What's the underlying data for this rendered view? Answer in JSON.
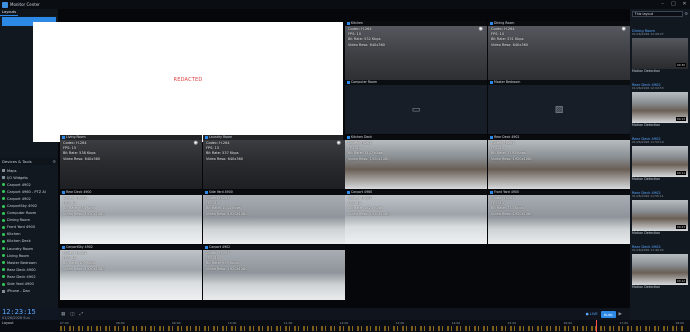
{
  "app": {
    "title": "Monitor Center"
  },
  "window_controls": [
    "–",
    "□",
    "✕"
  ],
  "left": {
    "tabs": [
      "Layouts"
    ],
    "cameras_header": "Devices & Tools",
    "items": [
      "Maps",
      "I/O Widgets",
      "Carport 4902",
      "Carport 4960 - PTZ Al",
      "Carport 4902",
      "CarportSky 4902",
      "Computer Room",
      "Dining Room",
      "Front Yard 4900",
      "Kitchen",
      "Kitchen Deck",
      "Laundry Room",
      "Living Room",
      "Master Bedroom",
      "Rear Deck 4900",
      "Rear Deck 4902",
      "Side Yard 4900",
      "iPhone - Dan"
    ]
  },
  "clock": {
    "time": "12:23:15",
    "date": "01/26/2026 Sun"
  },
  "grid": {
    "redacted_text": "REDACTED",
    "cams": [
      {
        "name": "Kitchen",
        "codec": "Codec: H.264",
        "fps": "FPS:  10",
        "bitrate": "Bit Rate: 532 Kbps",
        "res": "Video Reso:  640x360"
      },
      {
        "name": "Dining Room",
        "codec": "Codec: H.264",
        "fps": "FPS:  10",
        "bitrate": "Bit Rate: 531 Kbps",
        "res": "Video Reso:  640x360"
      },
      {
        "name": "Computer Room"
      },
      {
        "name": "Master Bedroom"
      },
      {
        "name": "Living Room",
        "codec": "Codec: H.264",
        "fps": "FPS:  15",
        "bitrate": "Bit Rate: 538 Kbps",
        "res": "Video Reso:  640x360"
      },
      {
        "name": "Laundry Room",
        "codec": "Codec: H.264",
        "fps": "FPS:  15",
        "bitrate": "Bit Rate: 537 Kbps",
        "res": "Video Reso:  640x360"
      },
      {
        "name": "Kitchen Deck",
        "codec": "Codec: H.264",
        "fps": "FPS:  15",
        "bitrate": "Bit Rate: 1147 Kbps",
        "res": "Video Reso:  1920x1080"
      },
      {
        "name": "Rear Deck 4902",
        "codec": "Codec: H.264",
        "fps": "FPS:  15",
        "bitrate": "Bit Rate: 1793 Kbps",
        "res": "Video Reso:  1920x1080"
      },
      {
        "name": "Rear Deck 4900",
        "codec": "Codec: H.264",
        "fps": "FPS:  15",
        "bitrate": "Bit Rate: 938 Kbps",
        "res": "Video Reso:  1920x1080"
      },
      {
        "name": "Side Yard 4900",
        "codec": "Codec: H.264",
        "fps": "FPS:  15",
        "bitrate": "Bit Rate: 1044 Kbps",
        "res": "Video Reso:  1920x1080"
      },
      {
        "name": "Carport 4960",
        "codec": "Codec: H.264",
        "fps": "FPS:  15",
        "bitrate": "Bit Rate: 1623 Kbps",
        "res": "Video Reso:  1920x1080"
      },
      {
        "name": "Front Yard 4900",
        "codec": "Codec: H.264",
        "fps": "FPS:  15",
        "bitrate": "Bit Rate: 733 Kbps",
        "res": "Video Reso:  1920x1080"
      },
      {
        "name": "CarportSky 4902",
        "codec": "Codec: H.264",
        "fps": "FPS:  15",
        "bitrate": "Bit Rate: 109 Kbps",
        "res": "Video Reso:  1920x1080"
      },
      {
        "name": "Carport 4902",
        "codec": "Codec: H.264",
        "fps": "FPS:  15",
        "bitrate": "Bit Rate: 959 Kbps",
        "res": "Video Reso:  1920x1080"
      }
    ]
  },
  "right": {
    "layout_select": "This layout",
    "events": [
      {
        "name": "Dining Room",
        "date": "01/26/2026 12:08:27",
        "stamp": "00:30",
        "type": "Motion Detection"
      },
      {
        "name": "Rear Deck 4902",
        "date": "01/26/2026 12:04:53",
        "stamp": "00:13",
        "type": "Motion Detection"
      },
      {
        "name": "Rear Deck 4902",
        "date": "01/26/2026 11:59:19",
        "stamp": "00:11",
        "type": "Motion Detection"
      },
      {
        "name": "Rear Deck 4902",
        "date": "01/26/2026 11:55:11",
        "stamp": "00:23",
        "type": "Motion Detection"
      },
      {
        "name": "Rear Deck 4902",
        "date": "01/26/2026 11:46:22",
        "stamp": "00:12",
        "type": "Motion Detection"
      }
    ]
  },
  "controls": {
    "live": "● LIVE",
    "mode": "Auto"
  },
  "timeline": {
    "label": "Layout",
    "ticks": [
      "07:00",
      "08:00",
      "09:00",
      "10:00",
      "11:00",
      "12:00",
      "13:00",
      "14:00",
      "15:00",
      "16:00",
      "17:00",
      "18:00"
    ]
  }
}
